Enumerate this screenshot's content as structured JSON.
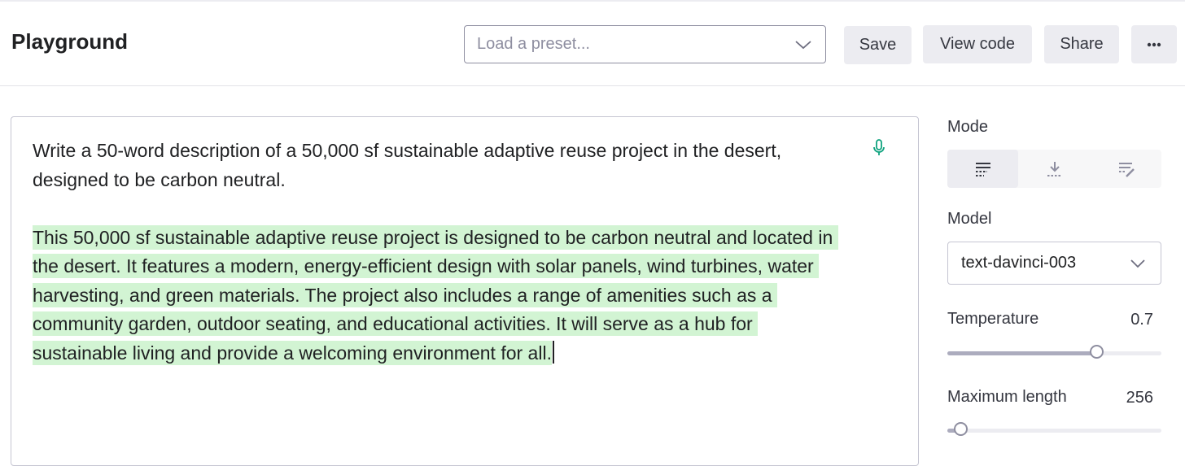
{
  "header": {
    "title": "Playground",
    "preset_placeholder": "Load a preset...",
    "save_label": "Save",
    "view_code_label": "View code",
    "share_label": "Share",
    "more_label": "···"
  },
  "editor": {
    "prompt": "Write a 50-word description of a 50,000 sf sustainable adaptive reuse project in the desert, designed to be carbon neutral.",
    "completion": "This 50,000 sf sustainable adaptive reuse project is designed to be carbon neutral and located in the desert. It features a modern, energy-efficient design with solar panels, wind turbines, water harvesting, and green materials. The project also includes a range of amenities such as a community garden, outdoor seating, and educational activities. It will serve as a hub for sustainable living and provide a welcoming environment for all.",
    "highlight_color": "#d2f4d3",
    "mic_icon": "microphone-icon",
    "mic_color": "#10a37f"
  },
  "sidebar": {
    "mode_label": "Mode",
    "mode_options": [
      {
        "icon": "complete-mode-icon",
        "selected": true
      },
      {
        "icon": "insert-mode-icon",
        "selected": false
      },
      {
        "icon": "edit-mode-icon",
        "selected": false
      }
    ],
    "model_label": "Model",
    "model_value": "text-davinci-003",
    "temperature_label": "Temperature",
    "temperature_value": "0.7",
    "temperature_fraction": 0.7,
    "max_length_label": "Maximum length",
    "max_length_value": "256",
    "max_length_fraction": 0.064
  }
}
